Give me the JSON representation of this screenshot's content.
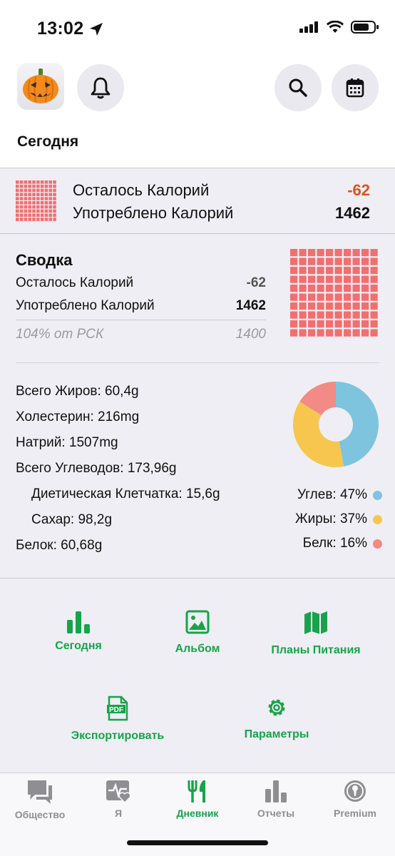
{
  "status_bar": {
    "time": "13:02"
  },
  "header": {
    "title": "Сегодня"
  },
  "calories_strip": {
    "remaining_label": "Осталось Калорий",
    "remaining_value": "-62",
    "consumed_label": "Употреблено Калорий",
    "consumed_value": "1462"
  },
  "summary": {
    "title": "Сводка",
    "remaining_label": "Осталось Калорий",
    "remaining_value": "-62",
    "consumed_label": "Употреблено Калорий",
    "consumed_value": "1462",
    "rsk_label": "104% от РСК",
    "rsk_value": "1400"
  },
  "nutrients": [
    {
      "label": "Всего Жиров: 60,4g"
    },
    {
      "label": "Холестерин: 216mg"
    },
    {
      "label": "Натрий: 1507mg"
    },
    {
      "label": "Всего Углеводов: 173,96g"
    },
    {
      "label": "Диетическая Клетчатка: 15,6g"
    },
    {
      "label": "Сахар: 98,2g"
    },
    {
      "label": "Белок: 60,68g"
    }
  ],
  "macro_chart": {
    "slices": [
      {
        "name": "Углев",
        "percent": 47,
        "label": "Углев: 47%",
        "color": "#7ec4de"
      },
      {
        "name": "Жиры",
        "percent": 37,
        "label": "Жиры: 37%",
        "color": "#f7c64f"
      },
      {
        "name": "Белк",
        "percent": 16,
        "label": "Белк: 16%",
        "color": "#f28a85"
      }
    ]
  },
  "tiles": {
    "today": "Сегодня",
    "album": "Альбом",
    "meal_plans": "Планы Питания",
    "export": "Экспортировать",
    "settings": "Параметры"
  },
  "tabbar": {
    "community": "Общество",
    "me": "Я",
    "diary": "Дневник",
    "reports": "Отчеты",
    "premium": "Premium"
  },
  "colors": {
    "accent": "#18a34a",
    "negative": "#e0521c",
    "grid": "#f26f6f"
  },
  "icons": {
    "avatar": "pumpkin-avatar-icon",
    "bell": "bell-icon",
    "search": "search-icon",
    "calendar": "calendar-icon"
  }
}
